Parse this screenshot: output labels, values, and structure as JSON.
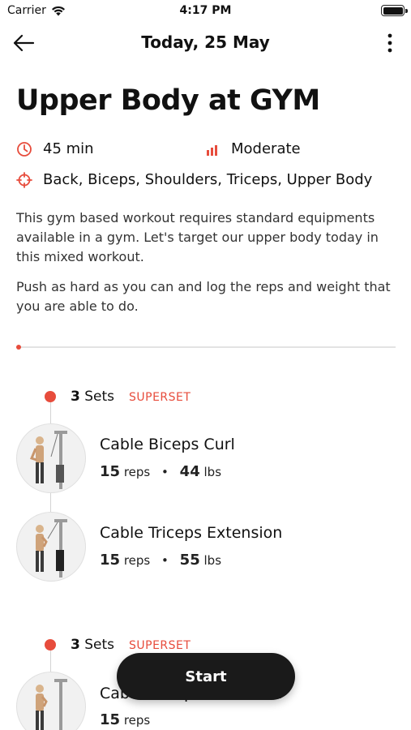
{
  "status_bar": {
    "carrier": "Carrier",
    "time": "4:17 PM"
  },
  "nav": {
    "title": "Today, 25 May",
    "back_icon": "arrow-left-icon",
    "more_icon": "more-vertical-icon"
  },
  "workout": {
    "title": "Upper Body at GYM",
    "duration": "45 min",
    "intensity": "Moderate",
    "muscles": "Back, Biceps, Shoulders, Triceps, Upper Body",
    "description_1": "This gym based workout requires standard equipments available in a gym. Let's target our upper body today in this mixed workout.",
    "description_2": "Push as hard as you can and log the reps and weight that you are able to do."
  },
  "progress": {
    "value": 0.0
  },
  "groups": [
    {
      "sets_count": "3",
      "sets_label": "Sets",
      "tag": "SUPERSET",
      "exercises": [
        {
          "name": "Cable Biceps Curl",
          "reps": "15",
          "reps_unit": "reps",
          "weight": "44",
          "weight_unit": "lbs"
        },
        {
          "name": "Cable Triceps Extension",
          "reps": "15",
          "reps_unit": "reps",
          "weight": "55",
          "weight_unit": "lbs"
        }
      ]
    },
    {
      "sets_count": "3",
      "sets_label": "Sets",
      "tag": "SUPERSET",
      "exercises": [
        {
          "name": "Cable Triceps Extension",
          "reps": "15",
          "reps_unit": "reps"
        }
      ]
    }
  ],
  "actions": {
    "start_label": "Start"
  },
  "colors": {
    "accent": "#e74c3c",
    "button_bg": "#1a1a1a"
  }
}
